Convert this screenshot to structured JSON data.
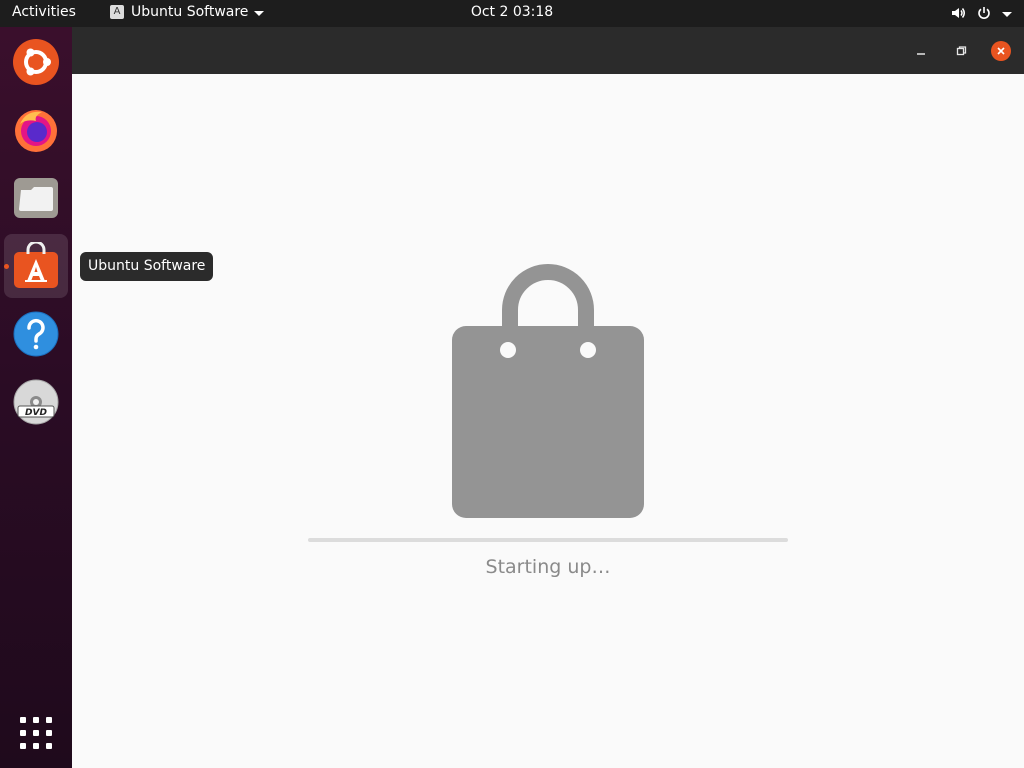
{
  "topbar": {
    "activities_label": "Activities",
    "app_menu_label": "Ubuntu Software",
    "clock": "Oct 2  03:18",
    "icons": [
      "volume-icon",
      "power-icon",
      "system-menu-caret-icon"
    ]
  },
  "dock": {
    "items": [
      {
        "name": "Ubuntu",
        "icon": "ubuntu-logo-icon"
      },
      {
        "name": "Firefox",
        "icon": "firefox-icon"
      },
      {
        "name": "Files",
        "icon": "files-icon"
      },
      {
        "name": "Ubuntu Software",
        "icon": "ubuntu-software-icon",
        "active": true
      },
      {
        "name": "Help",
        "icon": "help-icon"
      },
      {
        "name": "DVD",
        "icon": "dvd-icon"
      }
    ],
    "show_applications_icon": "show-apps-grid-icon"
  },
  "tooltip": {
    "label": "Ubuntu Software"
  },
  "window": {
    "controls": [
      "minimize-icon",
      "maximize-icon",
      "close-icon"
    ],
    "loading": {
      "status": "Starting up…",
      "progress": 0
    }
  },
  "colors": {
    "accent": "#e95420",
    "topbar": "#1d1d1d",
    "headerbar": "#2b2b2b",
    "content_bg": "#fafafa",
    "bag_gray": "#949494",
    "status_text": "#8a8a8a"
  }
}
